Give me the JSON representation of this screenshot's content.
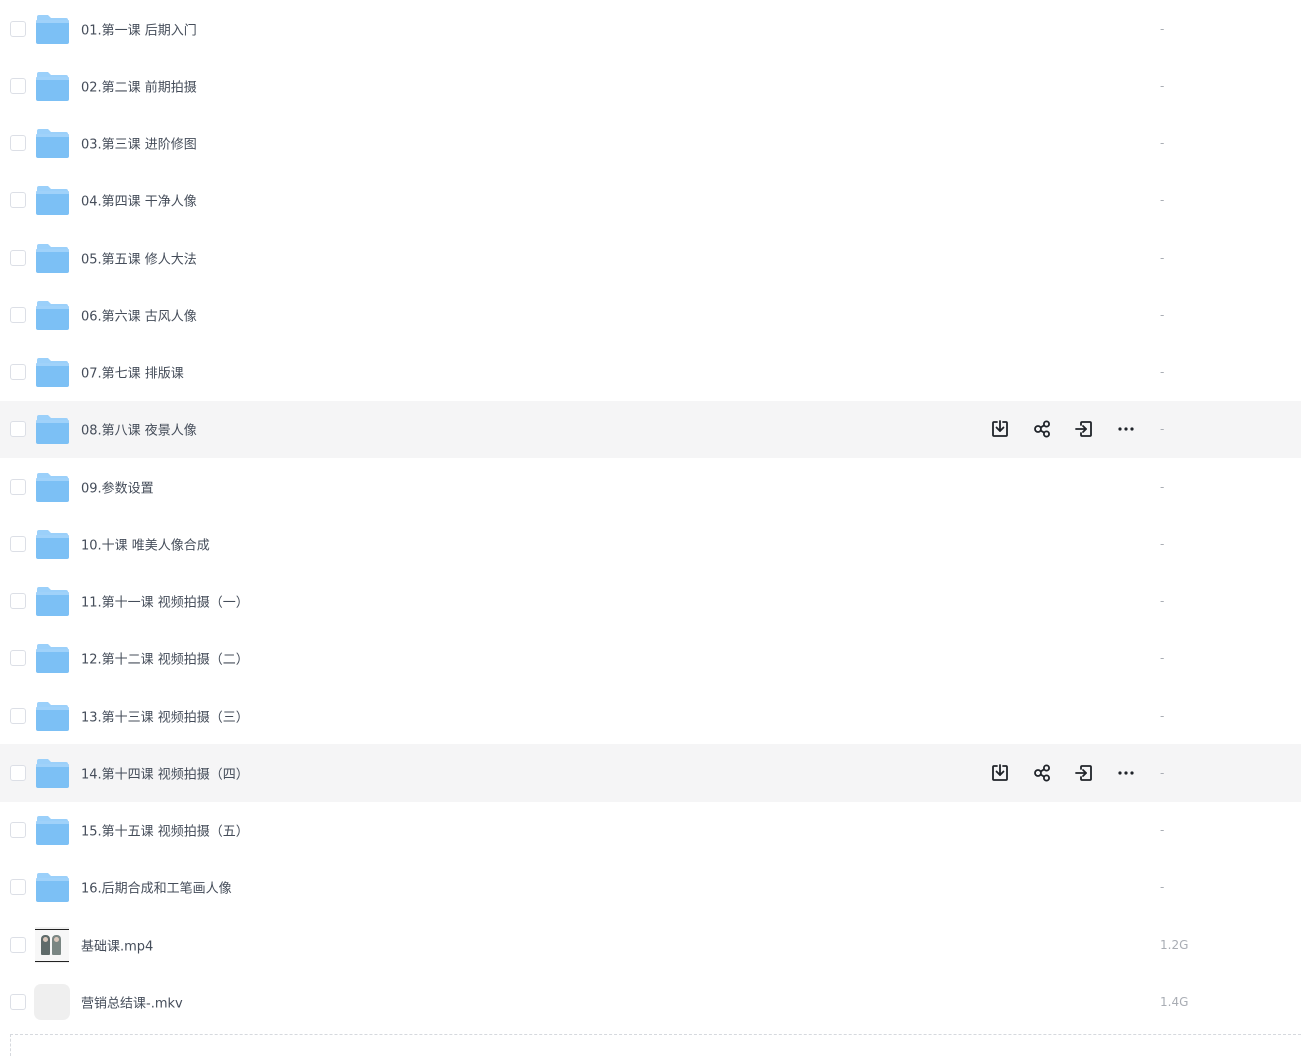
{
  "files": [
    {
      "name": "01.第一课 后期入门",
      "size": "-",
      "type": "folder",
      "hovered": false
    },
    {
      "name": "02.第二课 前期拍摄",
      "size": "-",
      "type": "folder",
      "hovered": false
    },
    {
      "name": "03.第三课 进阶修图",
      "size": "-",
      "type": "folder",
      "hovered": false
    },
    {
      "name": "04.第四课 干净人像",
      "size": "-",
      "type": "folder",
      "hovered": false
    },
    {
      "name": "05.第五课 修人大法",
      "size": "-",
      "type": "folder",
      "hovered": false
    },
    {
      "name": "06.第六课 古风人像",
      "size": "-",
      "type": "folder",
      "hovered": false
    },
    {
      "name": "07.第七课 排版课",
      "size": "-",
      "type": "folder",
      "hovered": false
    },
    {
      "name": "08.第八课 夜景人像",
      "size": "-",
      "type": "folder",
      "hovered": true
    },
    {
      "name": "09.参数设置",
      "size": "-",
      "type": "folder",
      "hovered": false
    },
    {
      "name": "10.十课 唯美人像合成",
      "size": "-",
      "type": "folder",
      "hovered": false
    },
    {
      "name": "11.第十一课 视频拍摄（一）",
      "size": "-",
      "type": "folder",
      "hovered": false
    },
    {
      "name": "12.第十二课 视频拍摄（二）",
      "size": "-",
      "type": "folder",
      "hovered": false
    },
    {
      "name": "13.第十三课 视频拍摄（三）",
      "size": "-",
      "type": "folder",
      "hovered": false
    },
    {
      "name": "14.第十四课 视频拍摄（四）",
      "size": "-",
      "type": "folder",
      "hovered": true
    },
    {
      "name": "15.第十五课 视频拍摄（五）",
      "size": "-",
      "type": "folder",
      "hovered": false
    },
    {
      "name": "16.后期合成和工笔画人像",
      "size": "-",
      "type": "folder",
      "hovered": false
    },
    {
      "name": "基础课.mp4",
      "size": "1.2G",
      "type": "video",
      "hovered": false
    },
    {
      "name": "营销总结课-.mkv",
      "size": "1.4G",
      "type": "blank",
      "hovered": false
    }
  ],
  "row_actions": [
    {
      "icon": "download-icon"
    },
    {
      "icon": "share-icon"
    },
    {
      "icon": "move-to-icon"
    },
    {
      "icon": "more-icon"
    }
  ],
  "colors": {
    "folder": "#7cc0f5",
    "folder_tab": "#9bd0fa",
    "hover_bg": "#f5f5f6",
    "text": "#454d5a",
    "size_text": "#a9adb4"
  }
}
